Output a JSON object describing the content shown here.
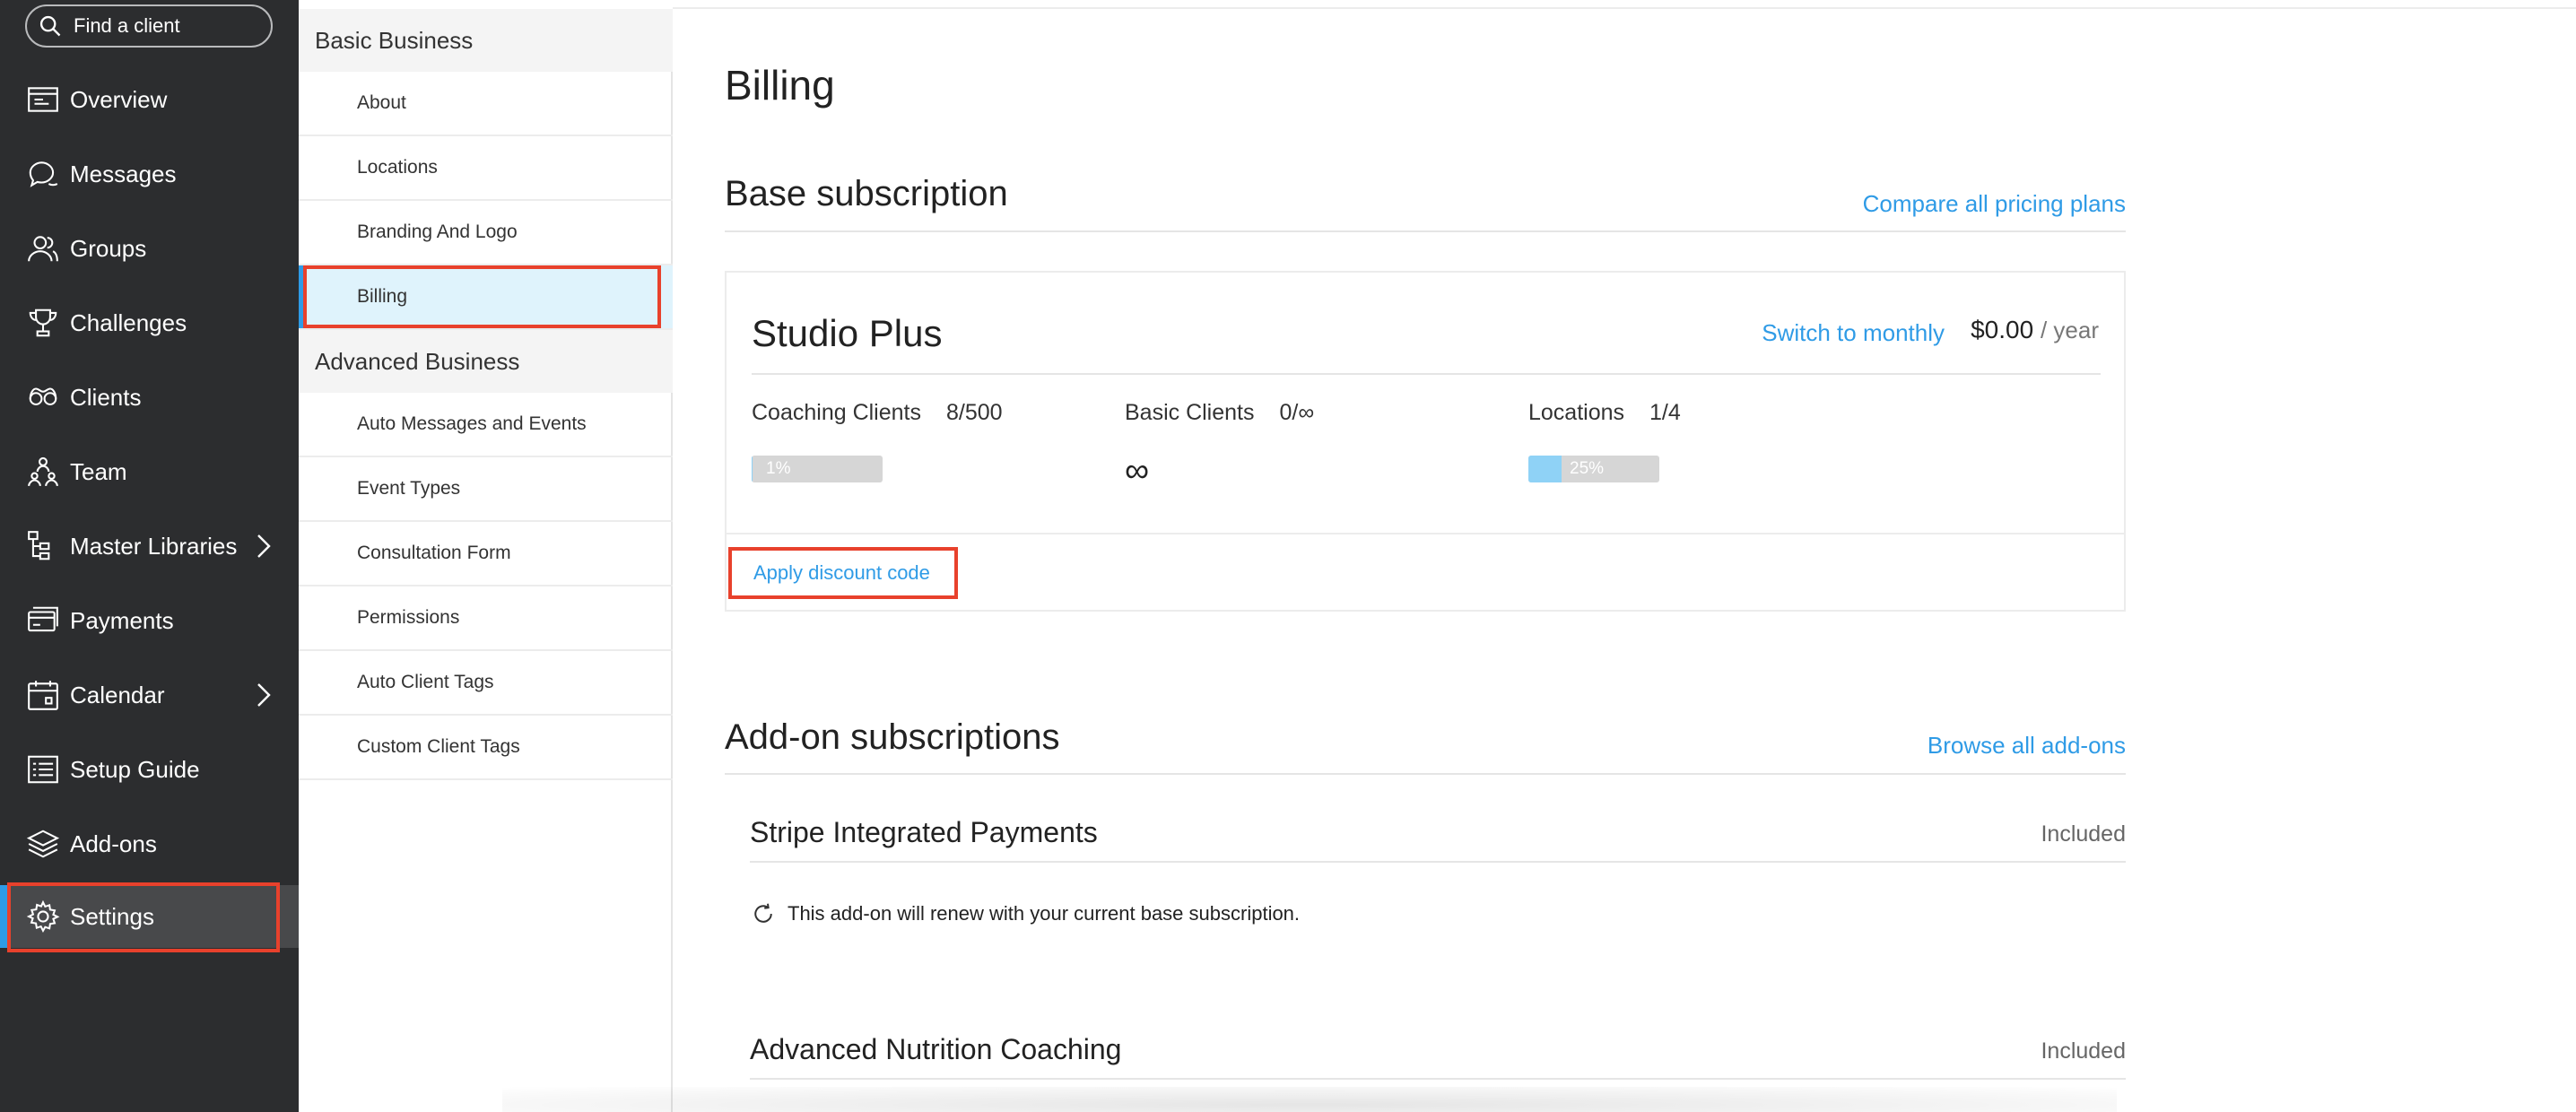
{
  "search": {
    "placeholder": "Find a client"
  },
  "sidebar": {
    "items": [
      {
        "label": "Overview",
        "icon": "overview-icon"
      },
      {
        "label": "Messages",
        "icon": "messages-icon"
      },
      {
        "label": "Groups",
        "icon": "groups-icon"
      },
      {
        "label": "Challenges",
        "icon": "trophy-icon"
      },
      {
        "label": "Clients",
        "icon": "clients-icon"
      },
      {
        "label": "Team",
        "icon": "team-icon"
      },
      {
        "label": "Master Libraries",
        "icon": "libraries-icon",
        "has_submenu": true
      },
      {
        "label": "Payments",
        "icon": "payments-icon"
      },
      {
        "label": "Calendar",
        "icon": "calendar-icon",
        "has_submenu": true
      },
      {
        "label": "Setup Guide",
        "icon": "setup-guide-icon"
      },
      {
        "label": "Add-ons",
        "icon": "add-ons-icon"
      },
      {
        "label": "Settings",
        "icon": "gear-icon",
        "active": true
      }
    ],
    "accent_color": "#2f9be6",
    "highlight_color": "#e8412c"
  },
  "subnav": {
    "basic_heading": "Basic Business",
    "basic_items": [
      "About",
      "Locations",
      "Branding And Logo",
      "Billing"
    ],
    "active_item": "Billing",
    "advanced_heading": "Advanced Business",
    "advanced_items": [
      "Auto Messages and Events",
      "Event Types",
      "Consultation Form",
      "Permissions",
      "Auto Client Tags",
      "Custom Client Tags"
    ]
  },
  "page": {
    "title": "Billing",
    "base": {
      "heading": "Base subscription",
      "compare_link": "Compare all pricing plans",
      "plan_name": "Studio Plus",
      "switch_link": "Switch to monthly",
      "price": "$0.00",
      "period": "/ year",
      "coaching_label": "Coaching Clients",
      "coaching_value": "8/500",
      "coaching_percent_label": "1%",
      "coaching_fraction": 0.01,
      "basic_label": "Basic Clients",
      "basic_value": "0/∞",
      "basic_symbol": "∞",
      "locations_label": "Locations",
      "locations_value": "1/4",
      "locations_percent_label": "25%",
      "locations_fraction": 0.25,
      "discount_link": "Apply discount code"
    },
    "addons": {
      "heading": "Add-on subscriptions",
      "browse_link": "Browse all add-ons",
      "items": [
        {
          "name": "Stripe Integrated Payments",
          "status": "Included",
          "note": "This add-on will renew with your current base subscription."
        },
        {
          "name": "Advanced Nutrition Coaching",
          "status": "Included"
        }
      ]
    }
  }
}
